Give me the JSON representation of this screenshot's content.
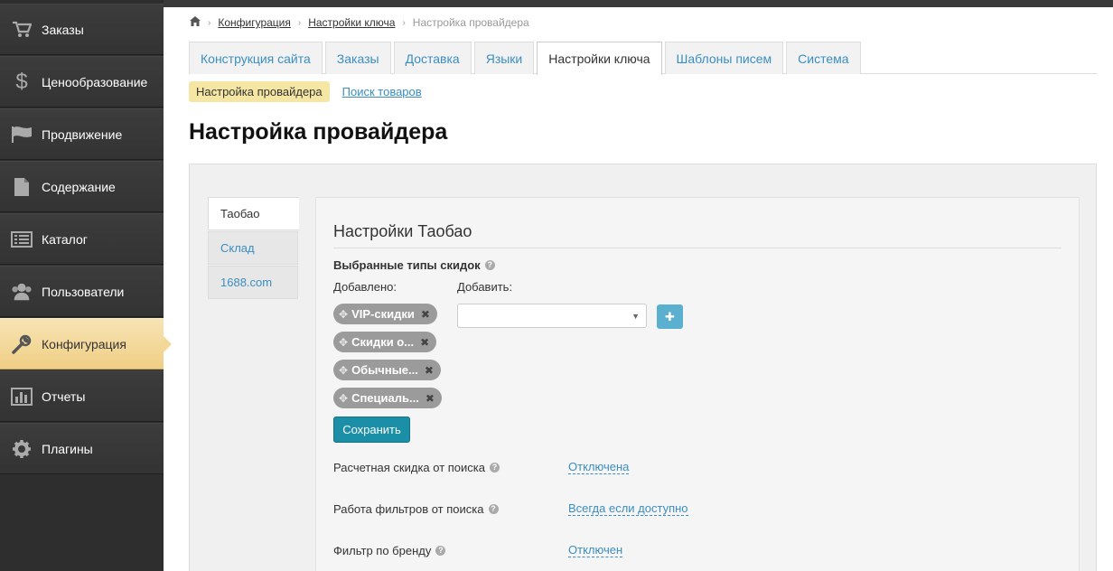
{
  "sidebar": {
    "items": [
      {
        "label": "Заказы",
        "icon": "cart-icon"
      },
      {
        "label": "Ценообразование",
        "icon": "dollar-icon"
      },
      {
        "label": "Продвижение",
        "icon": "flag-icon"
      },
      {
        "label": "Содержание",
        "icon": "document-icon"
      },
      {
        "label": "Каталог",
        "icon": "list-icon"
      },
      {
        "label": "Пользователи",
        "icon": "users-icon"
      },
      {
        "label": "Конфигурация",
        "icon": "wrench-icon"
      },
      {
        "label": "Отчеты",
        "icon": "bar-chart-icon"
      },
      {
        "label": "Плагины",
        "icon": "gear-icon"
      }
    ],
    "active_index": 6
  },
  "breadcrumb": {
    "home_icon": "home-icon",
    "items": [
      "Конфигурация",
      "Настройки ключа"
    ],
    "current": "Настройка провайдера"
  },
  "tabs": [
    {
      "label": "Конструкция сайта"
    },
    {
      "label": "Заказы"
    },
    {
      "label": "Доставка"
    },
    {
      "label": "Языки"
    },
    {
      "label": "Настройки ключа",
      "active": true
    },
    {
      "label": "Шаблоны писем"
    },
    {
      "label": "Система"
    }
  ],
  "subtabs": {
    "active": "Настройка провайдера",
    "link": "Поиск товаров"
  },
  "page_title": "Настройка провайдера",
  "vtabs": [
    {
      "label": "Таобао",
      "active": true
    },
    {
      "label": "Склад"
    },
    {
      "label": "1688.com"
    }
  ],
  "section": {
    "title": "Настройки Таобао",
    "discount_types_label": "Выбранные типы скидок",
    "added_label": "Добавлено:",
    "add_label": "Добавить:",
    "chips": [
      "VIP-скидки",
      "Скидки о...",
      "Обычные...",
      "Специаль..."
    ],
    "select_value": "",
    "save_label": "Сохранить",
    "settings": [
      {
        "label": "Расчетная скидка от поиска",
        "value": "Отключена"
      },
      {
        "label": "Работа фильтров от поиска",
        "value": "Всегда если доступно"
      },
      {
        "label": "Фильтр по бренду",
        "value": "Отключен"
      }
    ]
  },
  "colors": {
    "accent": "#3b8ec2",
    "save_button": "#1b8fa8",
    "active_sidebar": "#f0cf85",
    "subtab_highlight": "#f5e7a3"
  }
}
